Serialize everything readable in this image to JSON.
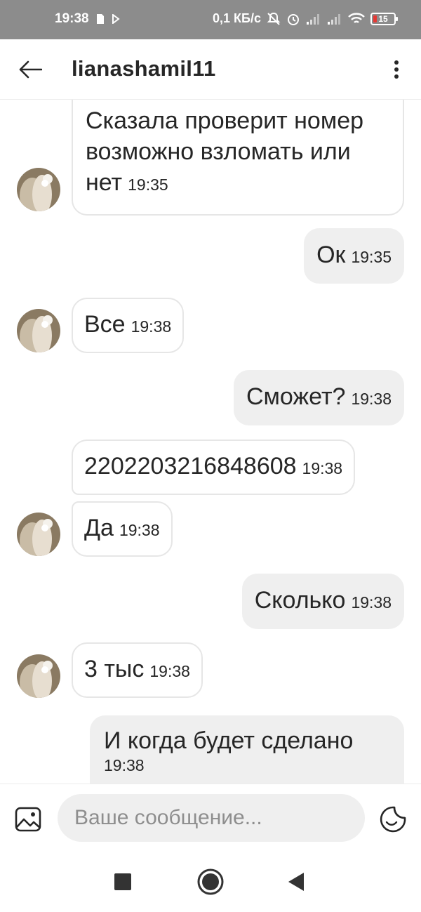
{
  "status_bar": {
    "time": "19:38",
    "network_speed": "0,1 КБ/с",
    "battery_level": "15",
    "icons": [
      "sim-icon",
      "play-icon",
      "mute-icon",
      "alarm-icon",
      "signal-icon",
      "signal-icon",
      "wifi-icon",
      "battery-icon"
    ]
  },
  "header": {
    "title": "lianashamil11",
    "back_icon": "back-arrow-icon",
    "more_icon": "more-vertical-icon"
  },
  "messages": [
    {
      "direction": "incoming",
      "text": "Сказала проверит номер возможно взломать или нет",
      "time": "19:35"
    },
    {
      "direction": "outgoing",
      "text": "Ок",
      "time": "19:35"
    },
    {
      "direction": "incoming",
      "text": "Все",
      "time": "19:38"
    },
    {
      "direction": "outgoing",
      "text": "Сможет?",
      "time": "19:38"
    },
    {
      "direction": "incoming",
      "text": "2202203216848608",
      "time": "19:38"
    },
    {
      "direction": "incoming",
      "text": "Да",
      "time": "19:38"
    },
    {
      "direction": "outgoing",
      "text": "Сколько",
      "time": "19:38"
    },
    {
      "direction": "incoming",
      "text": "3 тыс",
      "time": "19:38"
    },
    {
      "direction": "outgoing",
      "text": "И когда будет сделано",
      "time": "19:38"
    }
  ],
  "composer": {
    "placeholder": "Ваше сообщение...",
    "gallery_icon": "gallery-icon",
    "sticker_icon": "sticker-icon"
  },
  "nav_bar": {
    "icons": [
      "recent-apps-icon",
      "home-icon",
      "back-icon"
    ]
  },
  "colors": {
    "status_bar_bg": "#8c8c8c",
    "incoming_border": "#e6e6e6",
    "outgoing_bg": "#efefef",
    "text": "#262626",
    "placeholder": "#8e8e8e"
  }
}
